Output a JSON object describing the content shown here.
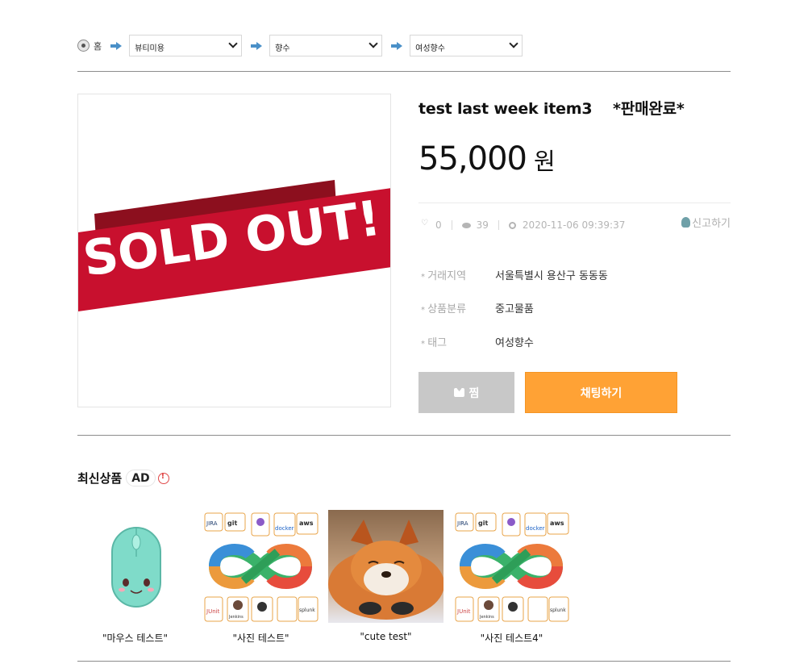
{
  "breadcrumb": {
    "home_label": "홈",
    "level1": "뷰티미용",
    "level2": "향수",
    "level3": "여성향수"
  },
  "product": {
    "title": "test last week item3    *판매완료*",
    "price": "55,000",
    "currency": "원",
    "image_text": "SOLD OUT!",
    "likes": "0",
    "views": "39",
    "date": "2020-11-06 09:39:37",
    "report_label": "신고하기",
    "info": [
      {
        "label": "거래지역",
        "value": "서울특별시 용산구 동동동"
      },
      {
        "label": "상품분류",
        "value": "중고물품"
      },
      {
        "label": "태그",
        "value": "여성향수"
      }
    ]
  },
  "buttons": {
    "zzim_label": "찜",
    "chat_label": "채팅하기"
  },
  "recent": {
    "title": "최신상품",
    "badge": "AD",
    "items": [
      {
        "caption": "\"마우스 테스트\""
      },
      {
        "caption": "\"사진 테스트\""
      },
      {
        "caption": "\"cute test\""
      },
      {
        "caption": "\"사진 테스트4\""
      }
    ],
    "devops_labels": [
      "JIRA",
      "git",
      "docker",
      "aws",
      "JUnit",
      "Jenkins",
      "splunk"
    ]
  },
  "colors": {
    "accent": "#ffa235",
    "sold_out_red": "#c8102e",
    "zzim_gray": "#c8c8c8"
  }
}
